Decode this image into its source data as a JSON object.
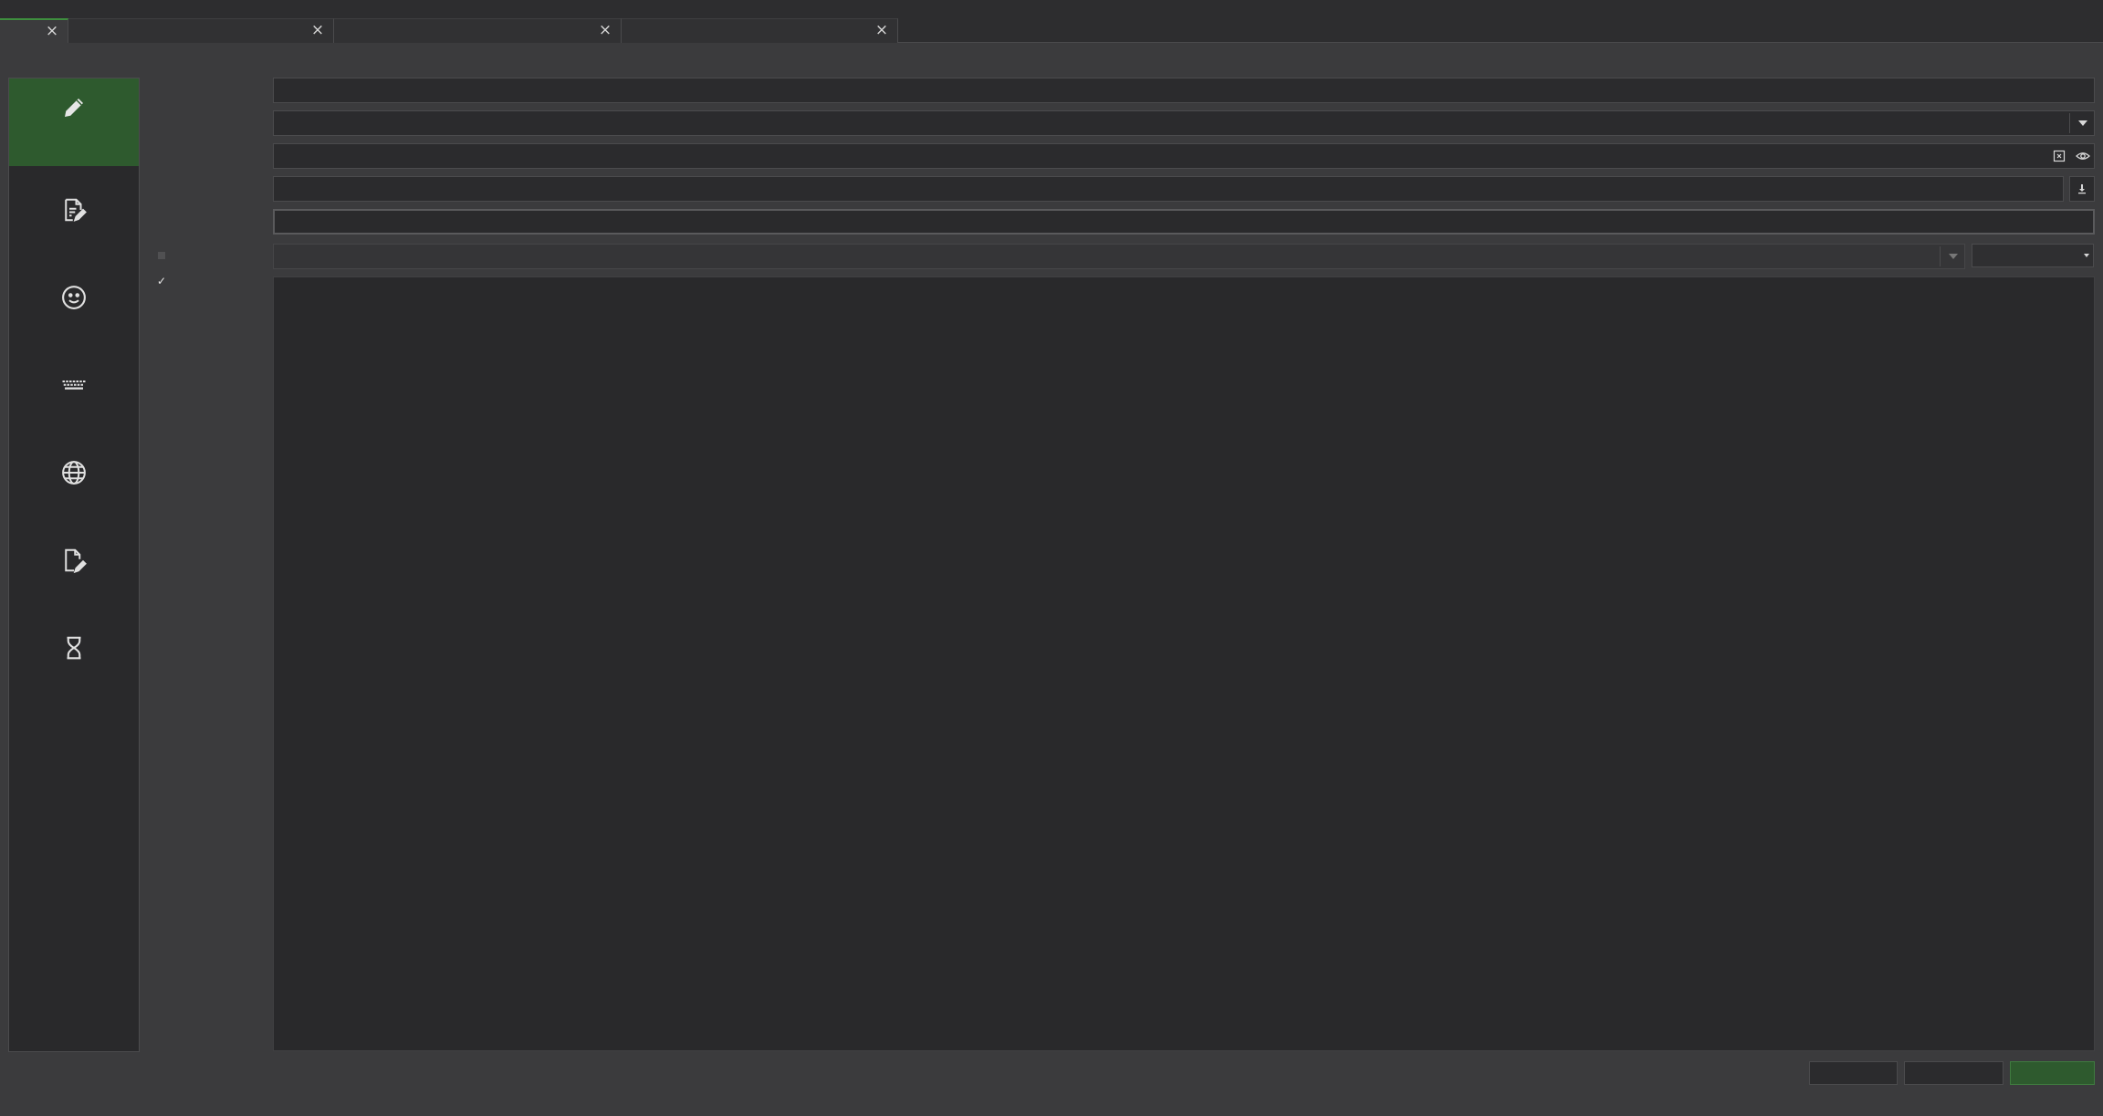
{
  "tabs": [
    {
      "label": "",
      "close_glyph": "×"
    },
    {
      "label": "",
      "close_glyph": "×"
    },
    {
      "label": "",
      "close_glyph": "×"
    },
    {
      "label": "",
      "close_glyph": "×"
    }
  ],
  "sidebar": {
    "items": [
      {
        "icon": "pencil-icon",
        "active": true
      },
      {
        "icon": "document-edit-icon",
        "active": false
      },
      {
        "icon": "smiley-icon",
        "active": false
      },
      {
        "icon": "keyboard-icon",
        "active": false
      },
      {
        "icon": "globe-icon",
        "active": false
      },
      {
        "icon": "file-edit-icon",
        "active": false
      },
      {
        "icon": "hourglass-icon",
        "active": false
      }
    ]
  },
  "form": {
    "field1_value": "",
    "field2_value": "",
    "field3_value": "",
    "field4_value": "",
    "field5_value": "",
    "disabled_select_value": "",
    "small_select_value": "",
    "checkbox1_checked": false,
    "checkbox2_checked": true,
    "checkbox2_glyph": "✓",
    "textarea_value": ""
  },
  "buttons": {
    "button1_label": "",
    "button2_label": "",
    "button3_label": ""
  },
  "colors": {
    "accent": "#2e5a2e",
    "accent_border": "#3e8e3e",
    "window_bg": "#3b3b3d",
    "field_bg": "#2b2b2d"
  }
}
